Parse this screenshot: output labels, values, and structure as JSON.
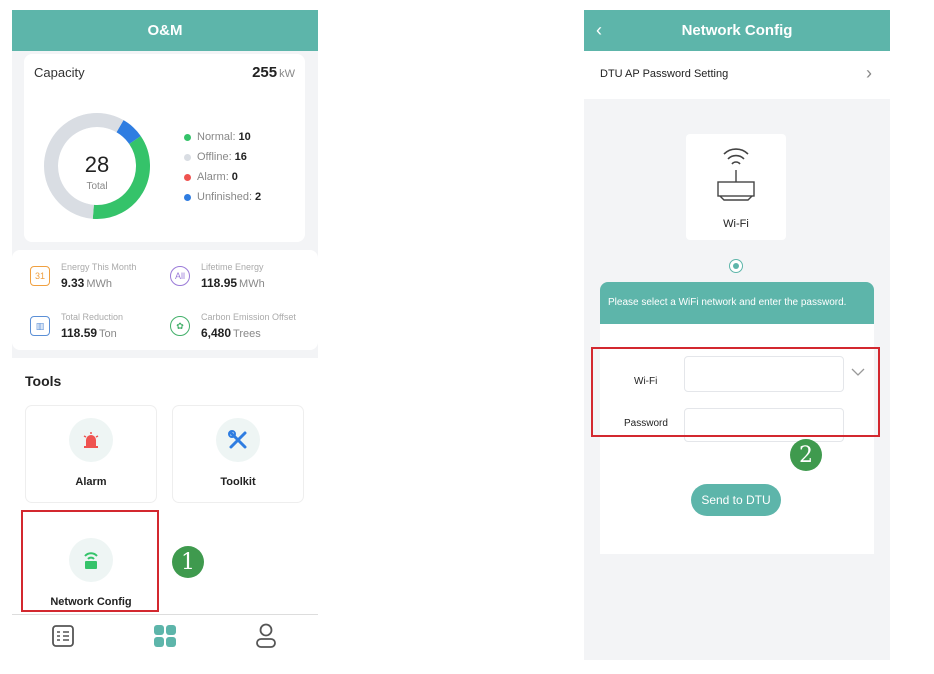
{
  "left": {
    "title": "O&M",
    "capacity": {
      "label": "Capacity",
      "value": "255",
      "unit": "kW"
    },
    "donut": {
      "total": "28",
      "total_label": "Total",
      "segments": [
        {
          "name": "Normal",
          "count": 10,
          "color": "#35c36a"
        },
        {
          "name": "Offline",
          "count": 16,
          "color": "#d9dde3"
        },
        {
          "name": "Alarm",
          "count": 0,
          "color": "#ef5350"
        },
        {
          "name": "Unfinished",
          "count": 2,
          "color": "#2f7de1"
        }
      ]
    },
    "legend": [
      {
        "label": "Normal:",
        "value": "10",
        "color": "#35c36a"
      },
      {
        "label": "Offline:",
        "value": "16",
        "color": "#d9dde3"
      },
      {
        "label": "Alarm:",
        "value": "0",
        "color": "#ef5350"
      },
      {
        "label": "Unfinished:",
        "value": "2",
        "color": "#2f7de1"
      }
    ],
    "stats": [
      {
        "label": "Energy This Month",
        "value": "9.33",
        "unit": "MWh",
        "icon": "calendar-icon",
        "icon_text": "31",
        "color": "#f0a040"
      },
      {
        "label": "Lifetime Energy",
        "value": "118.95",
        "unit": "MWh",
        "icon": "lifetime-energy-icon",
        "icon_text": "All",
        "color": "#9b7bd8"
      },
      {
        "label": "Total Reduction",
        "value": "118.59",
        "unit": "Ton",
        "icon": "factory-icon",
        "icon_text": "▥",
        "color": "#5b8fd6"
      },
      {
        "label": "Carbon Emission Offset",
        "value": "6,480",
        "unit": "Trees",
        "icon": "tree-icon",
        "icon_text": "✿",
        "color": "#43b06a"
      }
    ],
    "tools_title": "Tools",
    "tools": [
      {
        "label": "Alarm",
        "icon": "alarm-icon"
      },
      {
        "label": "Toolkit",
        "icon": "toolkit-icon"
      },
      {
        "label": "Network Config",
        "icon": "network-config-icon"
      }
    ],
    "step_badge": "1"
  },
  "right": {
    "title": "Network Config",
    "back_icon": "chevron-left-icon",
    "password_setting": "DTU AP Password Setting",
    "wifi_card_label": "Wi-Fi",
    "instruction": "Please select a WiFi network and enter the password.",
    "wifi_label": "Wi-Fi",
    "wifi_value": "",
    "password_label": "Password",
    "password_value": "",
    "send_button": "Send to DTU",
    "step_badge": "2"
  },
  "colors": {
    "accent": "#5db5aa",
    "highlight": "#d3282f",
    "badge": "#3f9a4e"
  }
}
